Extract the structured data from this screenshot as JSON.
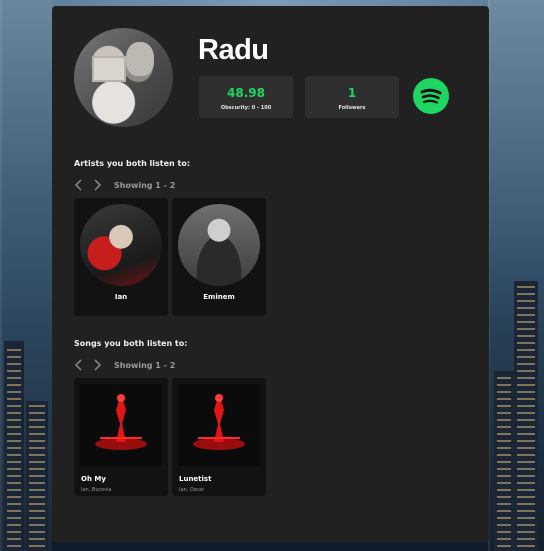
{
  "profile": {
    "name": "Radu",
    "obscurity": {
      "value": "48.98",
      "label": "Obscurity: 0 - 100"
    },
    "followers": {
      "value": "1",
      "label": "Followers"
    }
  },
  "artists": {
    "heading": "Artists you both listen to:",
    "range": "Showing 1 - 2",
    "items": [
      {
        "name": "Ian"
      },
      {
        "name": "Eminem"
      }
    ]
  },
  "songs": {
    "heading": "Songs you both listen to:",
    "range": "Showing 1 - 2",
    "items": [
      {
        "title": "Oh My",
        "artists": "Ian, Bvcovia"
      },
      {
        "title": "Lunetist",
        "artists": "Ian, Oscar"
      }
    ]
  },
  "colors": {
    "accent": "#1ed760",
    "panel": "#212121",
    "card": "#121212"
  },
  "icons": [
    "chevron-left-icon",
    "chevron-right-icon",
    "spotify-icon"
  ]
}
